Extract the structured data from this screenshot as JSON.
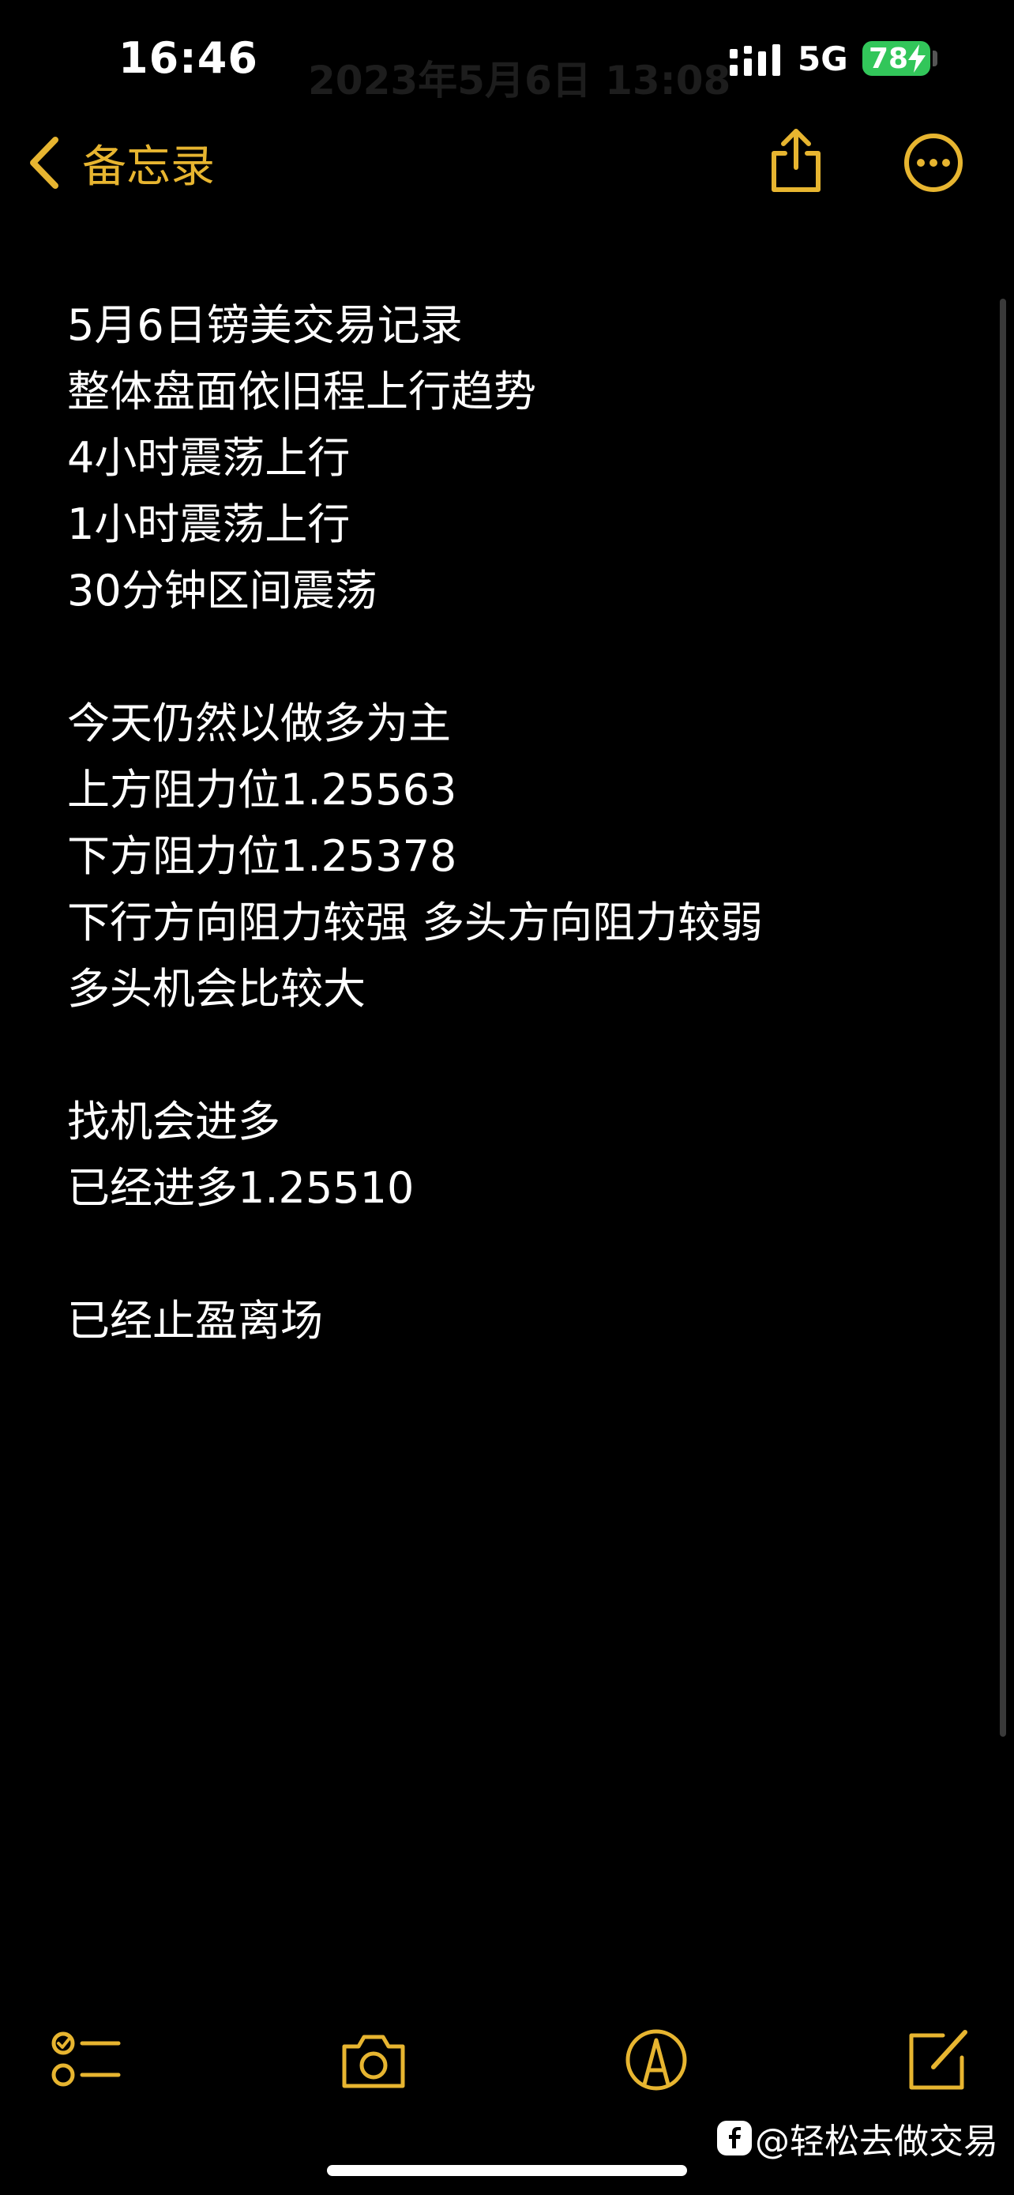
{
  "status_bar": {
    "time": "16:46",
    "ghost_title": "2023年5月6日 13:08",
    "network": "5G",
    "battery": "78"
  },
  "nav": {
    "back_label": "备忘录"
  },
  "note": {
    "lines": [
      "5月6日镑美交易记录",
      "整体盘面依旧程上行趋势",
      "4小时震荡上行",
      "1小时震荡上行",
      "30分钟区间震荡",
      "",
      "今天仍然以做多为主",
      "上方阻力位1.25563",
      "下方阻力位1.25378",
      "下行方向阻力较强 多头方向阻力较弱",
      "多头机会比较大",
      "",
      "找机会进多",
      "已经进多1.25510",
      "",
      "已经止盈离场"
    ]
  },
  "toolbar": {
    "items": [
      "checklist-icon",
      "camera-icon",
      "markup-pen-icon",
      "compose-icon"
    ]
  },
  "watermark": {
    "text": "@轻松去做交易"
  },
  "colors": {
    "accent": "#e7b530",
    "background": "#000000",
    "text": "#ffffff",
    "battery": "#32c65a"
  }
}
